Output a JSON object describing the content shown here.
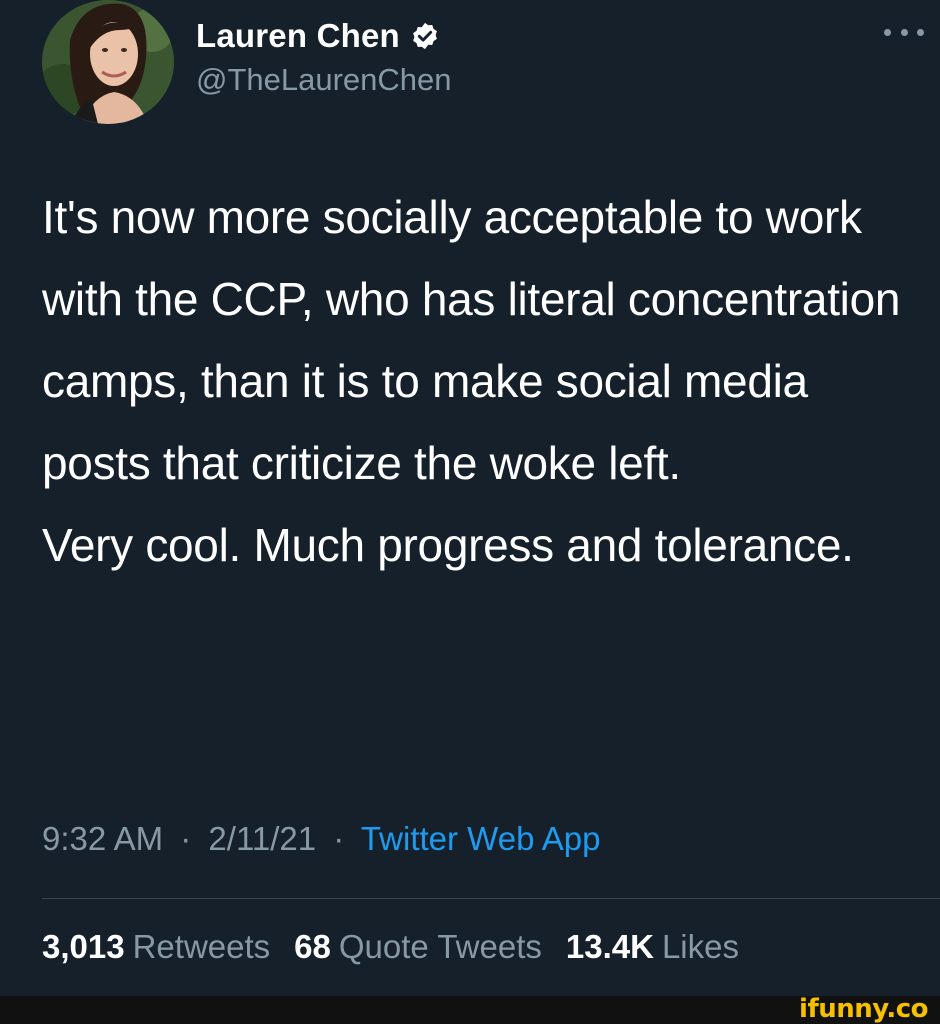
{
  "author": {
    "name": "Lauren Chen",
    "handle": "@TheLaurenChen",
    "verified": true,
    "verified_icon": "verified-badge-icon"
  },
  "tweet": {
    "paragraphs": [
      "It's now more socially acceptable to work with the CCP, who has literal concentration camps, than it is to make social media posts that criticize the woke left.",
      "Very cool. Much progress and tolerance."
    ]
  },
  "meta": {
    "time": "9:32 AM",
    "separator": "·",
    "date": "2/11/21",
    "source": "Twitter Web App"
  },
  "stats": [
    {
      "count": "3,013",
      "label": "Retweets"
    },
    {
      "count": "68",
      "label": "Quote Tweets"
    },
    {
      "count": "13.4K",
      "label": "Likes"
    }
  ],
  "watermark": "ifunny.co",
  "colors": {
    "background": "#15202b",
    "text_primary": "#ffffff",
    "text_secondary": "#8899a6",
    "link": "#1d9bf0",
    "divider": "#38444d",
    "watermark": "#f6c000"
  }
}
